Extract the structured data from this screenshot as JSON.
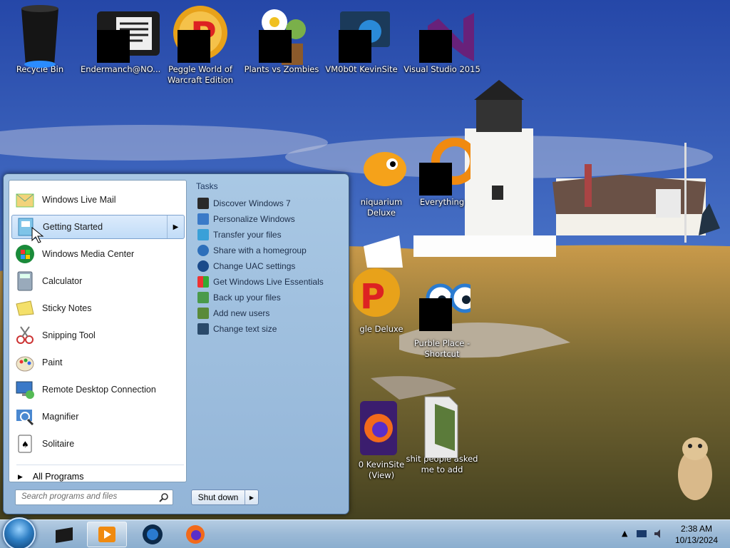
{
  "desktop": {
    "icons": [
      {
        "label": "Recycle Bin",
        "icon": "recycle-bin-icon"
      },
      {
        "label": "Endermanch@NO...",
        "icon": "text-file-icon"
      },
      {
        "label": "Peggle World of\nWarcraft Edition",
        "icon": "peggle-icon"
      },
      {
        "label": "Plants vs Zombies",
        "icon": "plants-vs-zombies-icon"
      },
      {
        "label": "VM0b0t KevinSite",
        "icon": "vm-icon"
      },
      {
        "label": "Visual Studio 2015",
        "icon": "visual-studio-icon"
      },
      {
        "label": "Everything",
        "icon": "everything-icon"
      },
      {
        "label": "niquarium\nDeluxe",
        "icon": "fish-icon"
      },
      {
        "label": "gle Deluxe",
        "icon": "peggle-deluxe-icon"
      },
      {
        "label": "Purble Place -\nShortcut",
        "icon": "purble-place-icon"
      },
      {
        "label": "0 KevinSite\n(View)",
        "icon": "firefox-icon"
      },
      {
        "label": "shit people asked\nme to add",
        "icon": "folder-icon"
      }
    ]
  },
  "start_menu": {
    "programs": [
      {
        "label": "Windows Live Mail",
        "icon": "mail-icon"
      },
      {
        "label": "Getting Started",
        "icon": "getting-started-icon",
        "selected": true
      },
      {
        "label": "Windows Media Center",
        "icon": "media-center-icon"
      },
      {
        "label": "Calculator",
        "icon": "calculator-icon"
      },
      {
        "label": "Sticky Notes",
        "icon": "sticky-notes-icon"
      },
      {
        "label": "Snipping Tool",
        "icon": "scissors-icon"
      },
      {
        "label": "Paint",
        "icon": "paint-icon"
      },
      {
        "label": "Remote Desktop Connection",
        "icon": "remote-desktop-icon"
      },
      {
        "label": "Magnifier",
        "icon": "magnifier-icon"
      },
      {
        "label": "Solitaire",
        "icon": "solitaire-icon"
      }
    ],
    "all_programs": "All Programs",
    "search_placeholder": "Search programs and files",
    "tasks_title": "Tasks",
    "tasks": [
      "Discover Windows 7",
      "Personalize Windows",
      "Transfer your files",
      "Share with a homegroup",
      "Change UAC settings",
      "Get Windows Live Essentials",
      "Back up your files",
      "Add new users",
      "Change text size"
    ],
    "shutdown_label": "Shut down"
  },
  "taskbar": {
    "time": "2:38 AM",
    "date": "10/13/2024",
    "pinned": [
      "start-orb",
      "explorer-icon",
      "media-player-icon",
      "globe-icon",
      "firefox-icon"
    ]
  },
  "colors": {
    "accent": "#2f7fc4",
    "taskbar": "#9bb9d6"
  }
}
